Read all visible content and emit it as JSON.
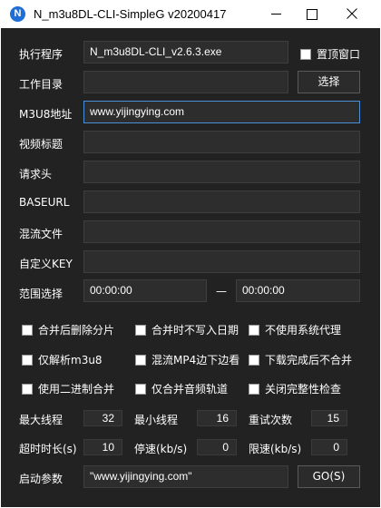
{
  "window": {
    "title": "N_m3u8DL-CLI-SimpleG v20200417",
    "icon_letter": "N"
  },
  "form": {
    "exe_label": "执行程序",
    "exe_value": "N_m3u8DL-CLI_v2.6.3.exe",
    "topmost_label": "置顶窗口",
    "workdir_label": "工作目录",
    "workdir_value": "",
    "choose_button": "选择",
    "m3u8_label": "M3U8地址",
    "m3u8_value": "www.yijingying.com",
    "video_title_label": "视频标题",
    "headers_label": "请求头",
    "baseurl_label": "BASEURL",
    "mux_file_label": "混流文件",
    "custom_key_label": "自定义KEY",
    "range_label": "范围选择",
    "range_start": "00:00:00",
    "range_sep": "—",
    "range_end": "00:00:00"
  },
  "checkboxes": [
    {
      "label": "合并后删除分片",
      "checked": false
    },
    {
      "label": "合并时不写入日期",
      "checked": false
    },
    {
      "label": "不使用系统代理",
      "checked": false
    },
    {
      "label": "仅解析m3u8",
      "checked": false
    },
    {
      "label": "混流MP4边下边看",
      "checked": false
    },
    {
      "label": "下载完成后不合并",
      "checked": false
    },
    {
      "label": "使用二进制合并",
      "checked": false
    },
    {
      "label": "仅合并音频轨道",
      "checked": false
    },
    {
      "label": "关闭完整性检查",
      "checked": false
    }
  ],
  "settings": {
    "max_threads_label": "最大线程",
    "max_threads": "32",
    "min_threads_label": "最小线程",
    "min_threads": "16",
    "retries_label": "重试次数",
    "retries": "15",
    "timeout_label": "超时时长(s)",
    "timeout": "10",
    "stop_speed_label": "停速(kb/s)",
    "stop_speed": "0",
    "limit_speed_label": "限速(kb/s)",
    "limit_speed": "0"
  },
  "launch": {
    "label": "启动参数",
    "value": "\"www.yijingying.com\"",
    "go_button": "GO(S)"
  }
}
